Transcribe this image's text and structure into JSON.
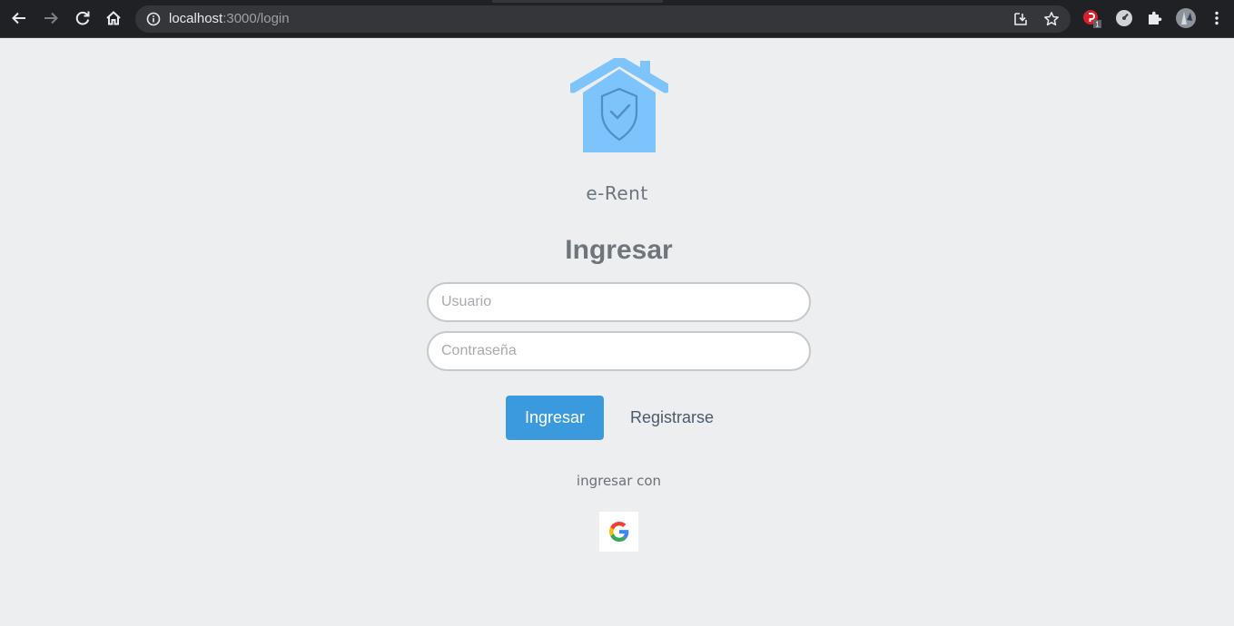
{
  "browser": {
    "url_host": "localhost",
    "url_path": ":3000/login",
    "extension_badge": "1"
  },
  "page": {
    "brand": "e-Rent",
    "heading": "Ingresar",
    "username_placeholder": "Usuario",
    "password_placeholder": "Contraseña",
    "login_button": "Ingresar",
    "register_link": "Registrarse",
    "login_with_text": "ingresar con",
    "accent_color": "#3b9ade",
    "logo_color": "#7cc4fb"
  }
}
